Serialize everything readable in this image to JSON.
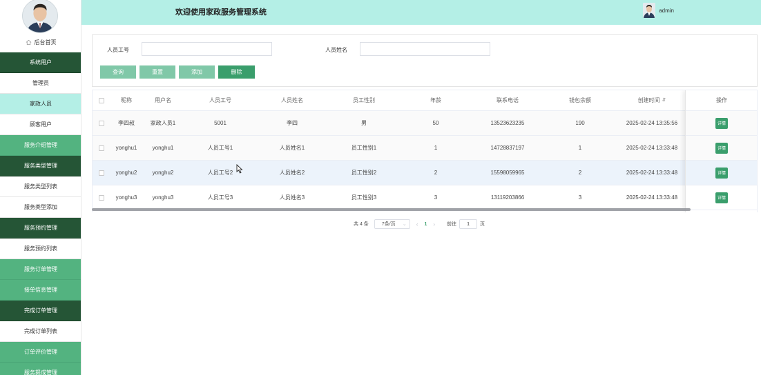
{
  "header": {
    "title": "欢迎使用家政服务管理系统",
    "username": "admin"
  },
  "sidebar": {
    "home_label": "后台首页",
    "items": [
      {
        "label": "系统用户",
        "style": "dark"
      },
      {
        "label": "管理员",
        "style": "sub"
      },
      {
        "label": "家政人员",
        "style": "active"
      },
      {
        "label": "顾客用户",
        "style": "sub"
      },
      {
        "label": "服务介绍管理",
        "style": "light"
      },
      {
        "label": "服务类型管理",
        "style": "dark"
      },
      {
        "label": "服务类型列表",
        "style": "sub"
      },
      {
        "label": "服务类型添加",
        "style": "sub"
      },
      {
        "label": "服务预约管理",
        "style": "dark"
      },
      {
        "label": "服务预约列表",
        "style": "sub"
      },
      {
        "label": "服务订单管理",
        "style": "light"
      },
      {
        "label": "接单信息管理",
        "style": "light"
      },
      {
        "label": "完成订单管理",
        "style": "dark"
      },
      {
        "label": "完成订单列表",
        "style": "sub"
      },
      {
        "label": "订单评价管理",
        "style": "light"
      },
      {
        "label": "服务提成管理",
        "style": "light"
      }
    ]
  },
  "search": {
    "field1_label": "人员工号",
    "field1_value": "",
    "field2_label": "人员姓名",
    "field2_value": "",
    "buttons": {
      "query": "查询",
      "reset": "重置",
      "add": "添加",
      "delete": "删除"
    }
  },
  "table": {
    "headers": {
      "nickname": "昵称",
      "username": "用户名",
      "staff_no": "人员工号",
      "staff_name": "人员姓名",
      "gender": "员工性别",
      "age": "年龄",
      "phone": "联系电话",
      "balance": "钱包余额",
      "created": "创建时间",
      "action": "操作"
    },
    "sort_icon": "⇵",
    "detail_label": "详情",
    "rows": [
      {
        "nickname": "李四叔",
        "username": "家政人员1",
        "staff_no": "5001",
        "staff_name": "李四",
        "gender": "男",
        "age": "50",
        "phone": "13523623235",
        "balance": "190",
        "created": "2025-02-24 13:35:56"
      },
      {
        "nickname": "yonghu1",
        "username": "yonghu1",
        "staff_no": "人员工号1",
        "staff_name": "人员姓名1",
        "gender": "员工性别1",
        "age": "1",
        "phone": "14728837197",
        "balance": "1",
        "created": "2025-02-24 13:33:48"
      },
      {
        "nickname": "yonghu2",
        "username": "yonghu2",
        "staff_no": "人员工号2",
        "staff_name": "人员姓名2",
        "gender": "员工性别2",
        "age": "2",
        "phone": "15598059965",
        "balance": "2",
        "created": "2025-02-24 13:33:48"
      },
      {
        "nickname": "yonghu3",
        "username": "yonghu3",
        "staff_no": "人员工号3",
        "staff_name": "人员姓名3",
        "gender": "员工性别3",
        "age": "3",
        "phone": "13119203866",
        "balance": "3",
        "created": "2025-02-24 13:33:48"
      }
    ]
  },
  "pagination": {
    "total": "共 4 条",
    "page_size": "7条/页",
    "current_page": "1",
    "goto_prefix": "前往",
    "goto_value": "1",
    "goto_suffix": "页"
  },
  "colors": {
    "header_bg": "#b4efe6",
    "sidebar_dark": "#255536",
    "sidebar_light": "#53b380",
    "accent": "#3a9e6c"
  }
}
